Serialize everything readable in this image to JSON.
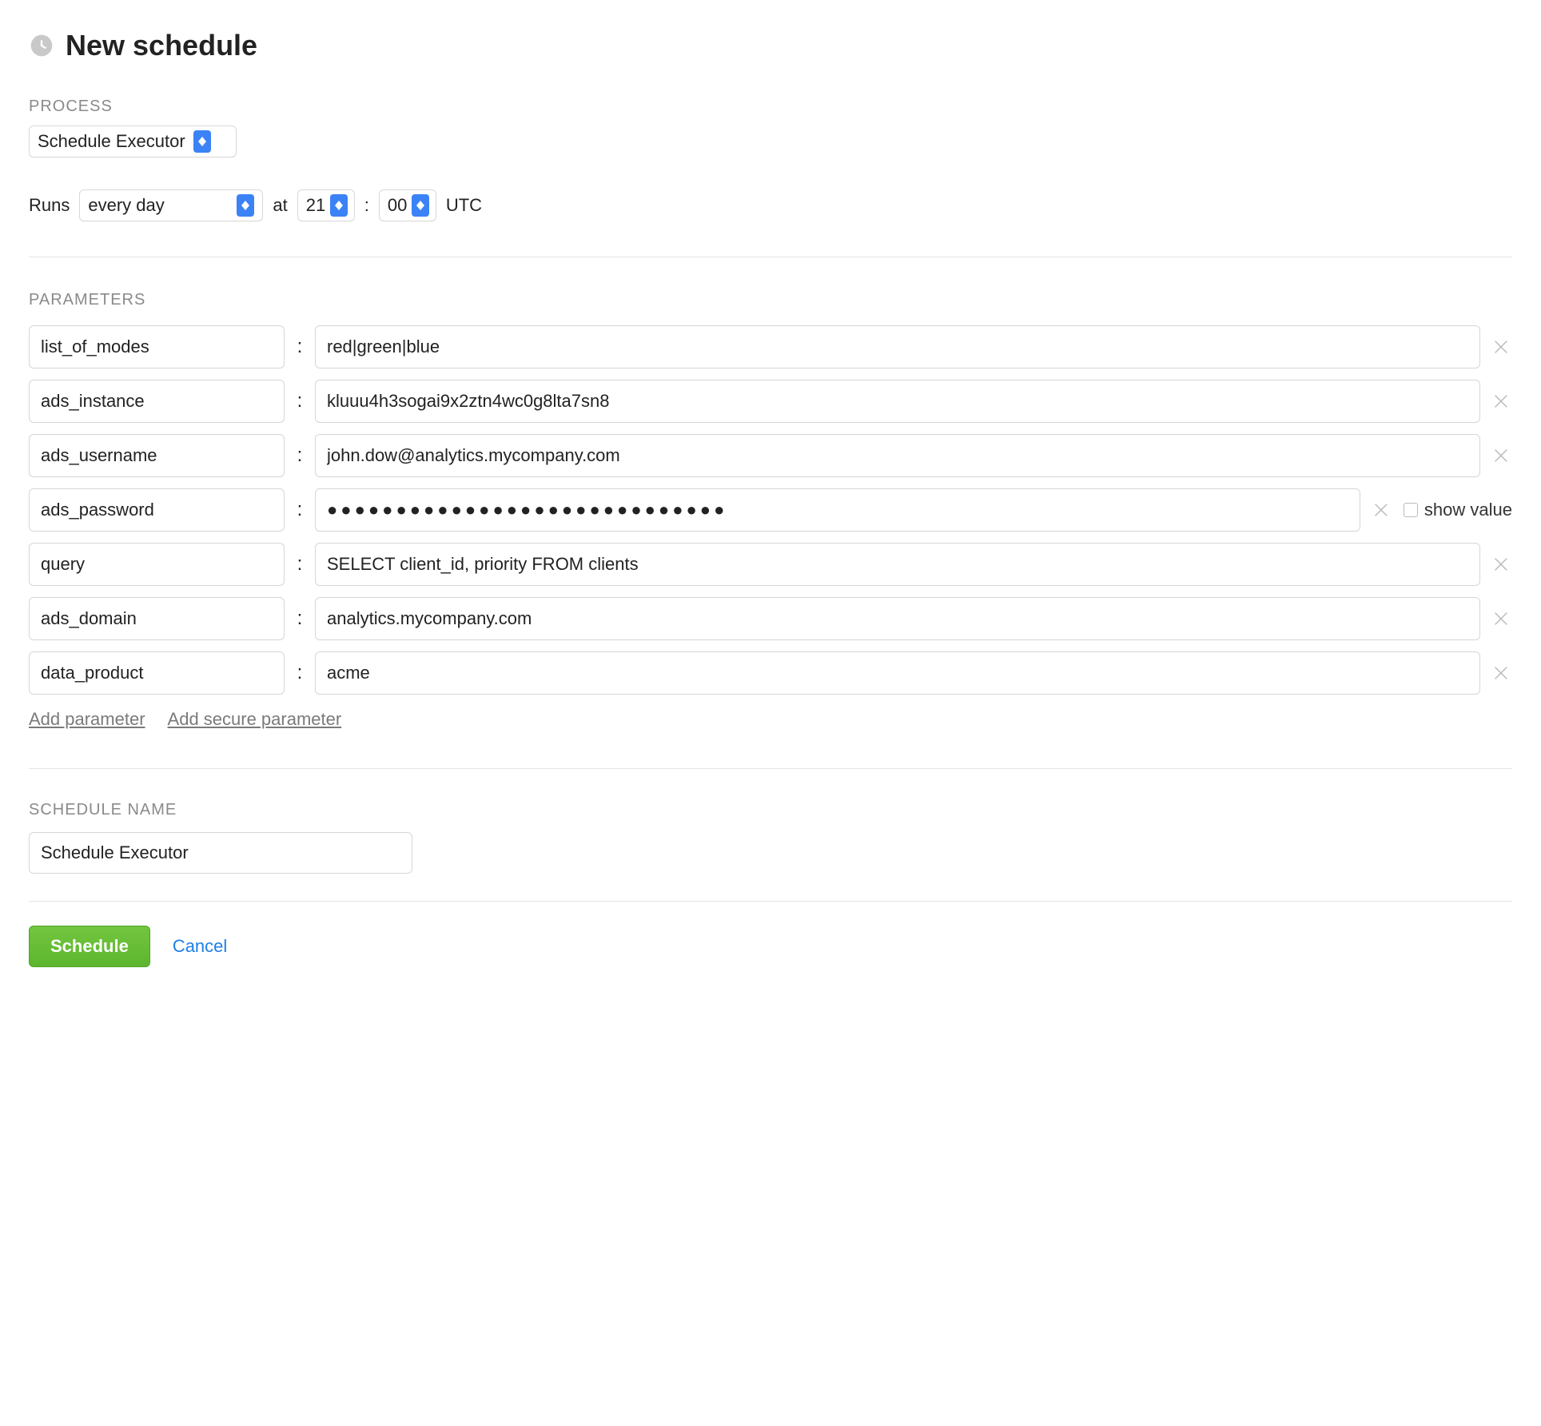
{
  "title": "New schedule",
  "process": {
    "label": "PROCESS",
    "selected": "Schedule Executor"
  },
  "runs": {
    "label": "Runs",
    "frequency": "every day",
    "at_label": "at",
    "hour": "21",
    "minute": "00",
    "separator": ":",
    "tz": "UTC"
  },
  "params_section": {
    "label": "PARAMETERS",
    "show_value_label": "show value",
    "add_param": "Add parameter",
    "add_secure_param": "Add secure parameter"
  },
  "params": [
    {
      "key": "list_of_modes",
      "value": "red|green|blue",
      "secure": false
    },
    {
      "key": "ads_instance",
      "value": "kluuu4h3sogai9x2ztn4wc0g8lta7sn8",
      "secure": false
    },
    {
      "key": "ads_username",
      "value": "john.dow@analytics.mycompany.com",
      "secure": false
    },
    {
      "key": "ads_password",
      "value": "●●●●●●●●●●●●●●●●●●●●●●●●●●●●●",
      "secure": true
    },
    {
      "key": "query",
      "value": "SELECT client_id, priority FROM clients",
      "secure": false
    },
    {
      "key": "ads_domain",
      "value": "analytics.mycompany.com",
      "secure": false
    },
    {
      "key": "data_product",
      "value": "acme",
      "secure": false
    }
  ],
  "schedule_name": {
    "label": "SCHEDULE NAME",
    "value": "Schedule Executor"
  },
  "actions": {
    "submit": "Schedule",
    "cancel": "Cancel"
  }
}
